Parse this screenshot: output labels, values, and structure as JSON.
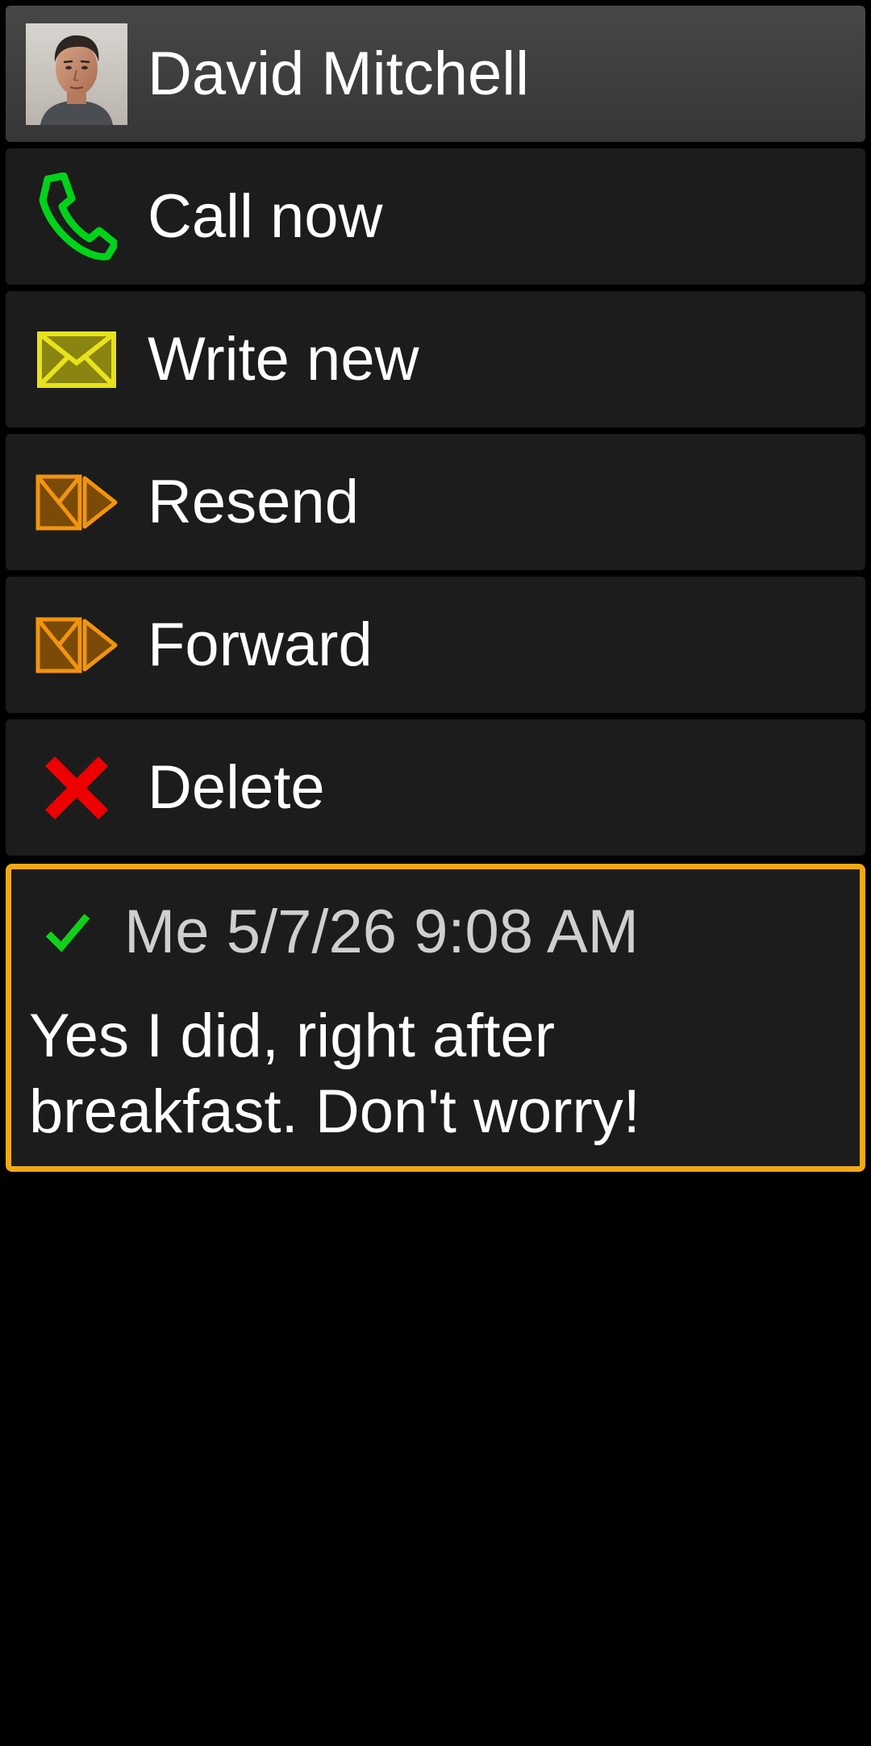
{
  "contact": {
    "name": "David Mitchell",
    "avatar_icon": "person-photo"
  },
  "actions": [
    {
      "id": "call",
      "label": "Call now",
      "icon": "phone-icon",
      "color": "#00d31a"
    },
    {
      "id": "write",
      "label": "Write new",
      "icon": "envelope-icon",
      "color": "#e8e21a"
    },
    {
      "id": "resend",
      "label": "Resend",
      "icon": "resend-icon",
      "color": "#f2940f"
    },
    {
      "id": "forward",
      "label": "Forward",
      "icon": "forward-icon",
      "color": "#f2940f"
    },
    {
      "id": "delete",
      "label": "Delete",
      "icon": "delete-x-icon",
      "color": "#ee0000"
    }
  ],
  "message": {
    "status_icon": "checkmark-icon",
    "sender": "Me",
    "timestamp": "5/7/26 9:08 AM",
    "meta": "Me 5/7/26 9:08 AM",
    "body_line1": "Yes I did, right after",
    "body_line2": "breakfast. Don't worry!",
    "highlight_color": "#f2a816"
  }
}
